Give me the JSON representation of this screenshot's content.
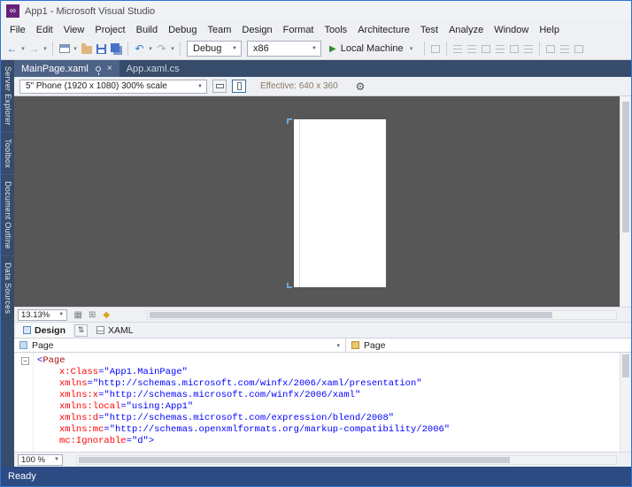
{
  "window": {
    "title": "App1 - Microsoft Visual Studio"
  },
  "menu": {
    "items": [
      "File",
      "Edit",
      "View",
      "Project",
      "Build",
      "Debug",
      "Team",
      "Design",
      "Format",
      "Tools",
      "Architecture",
      "Test",
      "Analyze",
      "Window",
      "Help"
    ]
  },
  "toolbar": {
    "configuration": "Debug",
    "platform": "x86",
    "run_target": "Local Machine"
  },
  "document_tabs": [
    {
      "label": "MainPage.xaml",
      "active": true
    },
    {
      "label": "App.xaml.cs",
      "active": false
    }
  ],
  "side_tabs": [
    "Server Explorer",
    "Toolbox",
    "Document Outline",
    "Data Sources"
  ],
  "designer": {
    "device_selector": "5\" Phone (1920 x 1080) 300% scale",
    "effective_label": "Effective: 640 x 360",
    "zoom": "13.13%"
  },
  "split_bar": {
    "design_label": "Design",
    "xaml_label": "XAML"
  },
  "breadcrumb": {
    "left": "Page",
    "right": "Page"
  },
  "editor": {
    "zoom": "100 %",
    "code_lines": [
      {
        "indent": 0,
        "tokens": [
          {
            "c": "delim",
            "s": "<"
          },
          {
            "c": "name",
            "s": "Page"
          }
        ]
      },
      {
        "indent": 1,
        "tokens": [
          {
            "c": "attr",
            "s": "x:Class"
          },
          {
            "c": "delim",
            "s": "="
          },
          {
            "c": "value",
            "s": "\"App1.MainPage\""
          }
        ]
      },
      {
        "indent": 1,
        "tokens": [
          {
            "c": "attr",
            "s": "xmlns"
          },
          {
            "c": "delim",
            "s": "="
          },
          {
            "c": "value",
            "s": "\"http://schemas.microsoft.com/winfx/2006/xaml/presentation\""
          }
        ]
      },
      {
        "indent": 1,
        "tokens": [
          {
            "c": "attr",
            "s": "xmlns:x"
          },
          {
            "c": "delim",
            "s": "="
          },
          {
            "c": "value",
            "s": "\"http://schemas.microsoft.com/winfx/2006/xaml\""
          }
        ]
      },
      {
        "indent": 1,
        "tokens": [
          {
            "c": "attr",
            "s": "xmlns:local"
          },
          {
            "c": "delim",
            "s": "="
          },
          {
            "c": "value",
            "s": "\"using:App1\""
          }
        ]
      },
      {
        "indent": 1,
        "tokens": [
          {
            "c": "attr",
            "s": "xmlns:d"
          },
          {
            "c": "delim",
            "s": "="
          },
          {
            "c": "value",
            "s": "\"http://schemas.microsoft.com/expression/blend/2008\""
          }
        ]
      },
      {
        "indent": 1,
        "tokens": [
          {
            "c": "attr",
            "s": "xmlns:mc"
          },
          {
            "c": "delim",
            "s": "="
          },
          {
            "c": "value",
            "s": "\"http://schemas.openxmlformats.org/markup-compatibility/2006\""
          }
        ]
      },
      {
        "indent": 1,
        "tokens": [
          {
            "c": "attr",
            "s": "mc:Ignorable"
          },
          {
            "c": "delim",
            "s": "="
          },
          {
            "c": "value",
            "s": "\"d\""
          },
          {
            "c": "delim",
            "s": ">"
          }
        ]
      }
    ]
  },
  "status_bar": {
    "text": "Ready"
  },
  "icons": {
    "logo": "∞",
    "back": "←",
    "forward": "→",
    "undo": "↶",
    "redo": "↷",
    "caret": "▾",
    "combo_caret": "▼",
    "play": "▶",
    "gear": "⚙",
    "close": "×",
    "swap": "⇅",
    "grid": "▦",
    "snap_grid": "⊞",
    "snaplines": "◆",
    "collapse": "−"
  },
  "colors": {
    "accent_border": "#2E75D1",
    "tab_strip": "#374B6B",
    "active_tab": "#4D6287",
    "status_bar": "#2B4B82",
    "design_surface": "#575757",
    "logo_purple": "#68217A",
    "run_green": "#388A34",
    "xml_name": "#A31515",
    "xml_attribute": "#FF0000",
    "xml_value": "#0000FF",
    "xml_delimiter": "#0000FF"
  }
}
